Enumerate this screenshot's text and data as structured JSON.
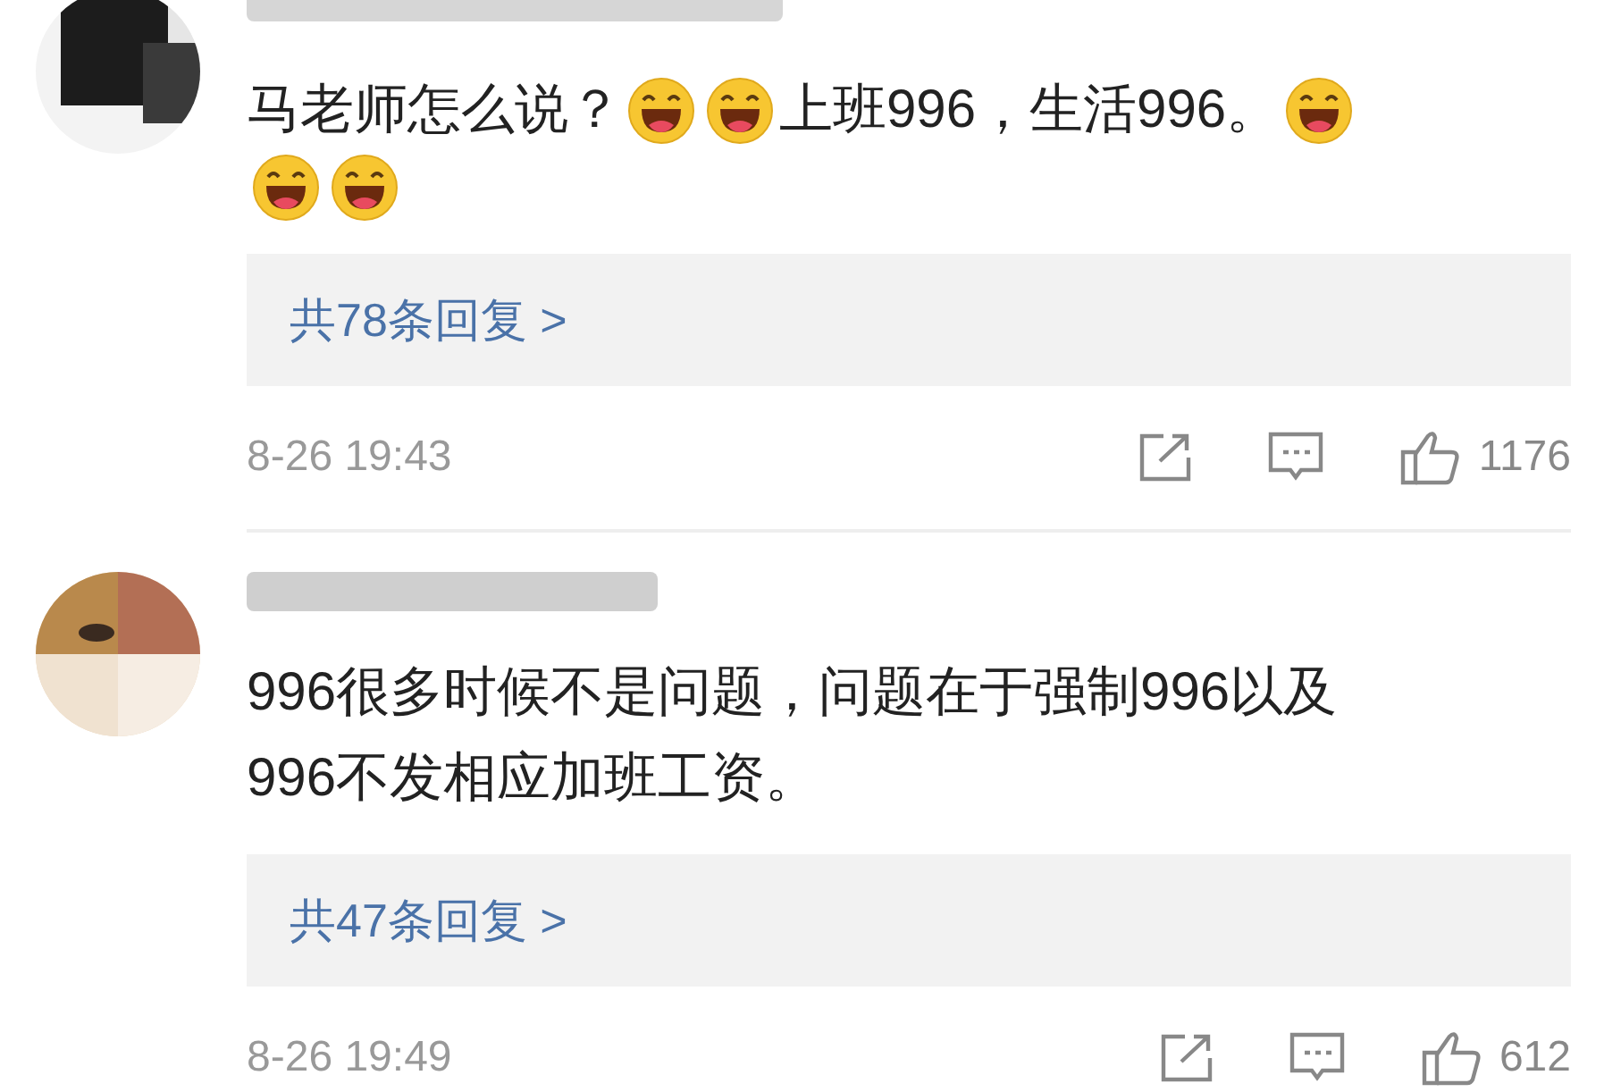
{
  "comments": [
    {
      "content": [
        {
          "kind": "text",
          "text": "马老师怎么说？"
        },
        {
          "kind": "emoji"
        },
        {
          "kind": "emoji"
        },
        {
          "kind": "text",
          "text": "上班996，生活996。"
        },
        {
          "kind": "emoji"
        },
        {
          "kind": "break"
        },
        {
          "kind": "emoji"
        },
        {
          "kind": "emoji"
        }
      ],
      "replies": "共78条回复 >",
      "time": "8-26 19:43",
      "likes": "1176"
    },
    {
      "content": [
        {
          "kind": "text",
          "text": "996很多时候不是问题，问题在于强制996以及"
        },
        {
          "kind": "break"
        },
        {
          "kind": "text",
          "text": "996不发相应加班工资。"
        }
      ],
      "replies": "共47条回复 >",
      "time": "8-26 19:49",
      "likes": "612"
    }
  ]
}
